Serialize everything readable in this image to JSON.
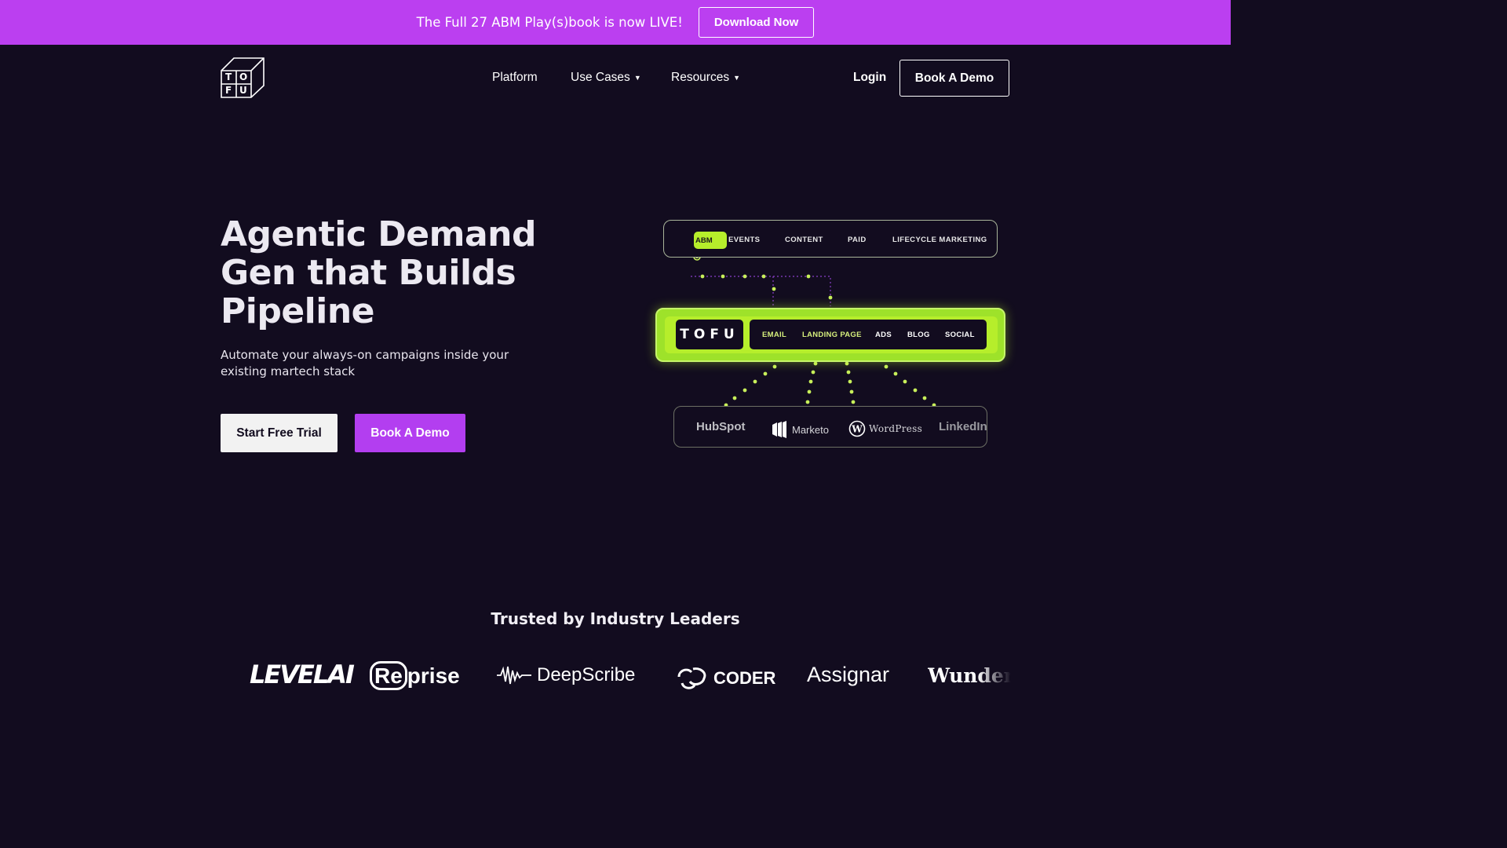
{
  "banner": {
    "text": "The Full 27 ABM Play(s)book is now LIVE!",
    "button": "Download Now",
    "bg_color": "#bb3ff0"
  },
  "logo": {
    "letters": [
      "T",
      "O",
      "F",
      "U"
    ]
  },
  "nav": {
    "items": [
      {
        "label": "Platform",
        "has_dropdown": false
      },
      {
        "label": "Use Cases",
        "has_dropdown": true
      },
      {
        "label": "Resources",
        "has_dropdown": true
      }
    ],
    "login": "Login",
    "demo_button": "Book A Demo"
  },
  "hero": {
    "title": "Agentic Demand Gen that Builds Pipeline",
    "subtitle": "Automate your always-on campaigns inside your existing martech stack",
    "primary_button": "Start Free Trial",
    "secondary_button": "Book A Demo",
    "accent_color": "#b33ef0"
  },
  "diagram": {
    "tabs": [
      "ABM",
      "EVENTS",
      "CONTENT",
      "PAID",
      "LIFECYCLE MARKETING"
    ],
    "active_tab": "ABM",
    "brand": "TOFU",
    "channels": [
      "EMAIL",
      "LANDING PAGE",
      "ADS",
      "BLOG",
      "SOCIAL"
    ],
    "active_channels": [
      "EMAIL",
      "LANDING PAGE"
    ],
    "integrations": [
      "HubSpot",
      "Marketo",
      "WordPress",
      "LinkedIn"
    ],
    "accent_color": "#b6ee2b"
  },
  "trusted": {
    "heading": "Trusted by Industry Leaders",
    "logos": [
      "LEVELAI",
      "Re",
      "prise",
      "DeepScribe",
      "CODER",
      "Assignar",
      "Wunder"
    ]
  }
}
